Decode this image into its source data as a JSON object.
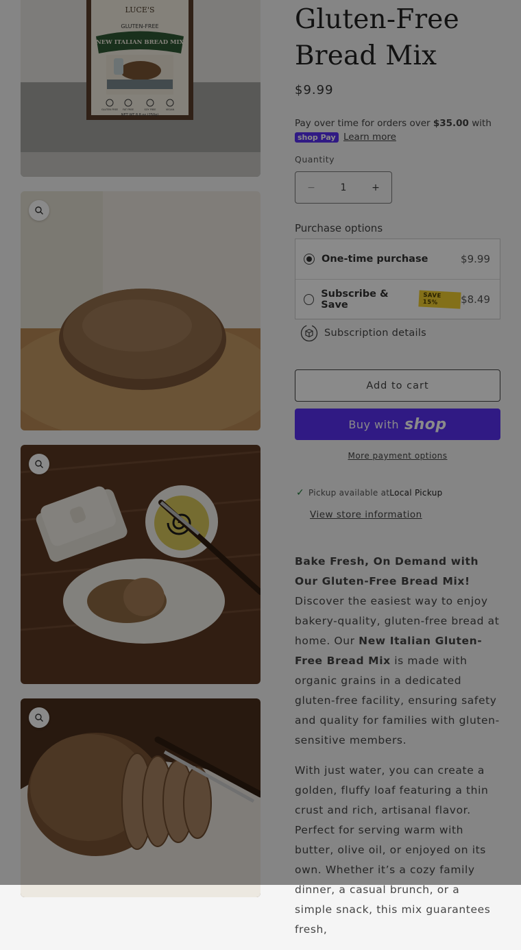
{
  "product": {
    "title": "Gluten-Free Bread Mix",
    "price": "$9.99",
    "installments": {
      "text": "Pay over time for orders over ",
      "threshold": "$35.00",
      "text_after": " with",
      "shoppay": "shop Pay",
      "learn_more": "Learn more"
    },
    "package": {
      "brand": "LUCE'S",
      "tag": "GLUTEN-FREE",
      "name": "NEW ITALIAN BREAD MIX",
      "net_wt": "NET WT 8.8 oz (250g)",
      "labels": [
        "GLUTEN FREE",
        "FAT FREE",
        "SOY FREE",
        "VEGAN"
      ]
    }
  },
  "quantity": {
    "label": "Quantity",
    "minus": "−",
    "value": "1",
    "plus": "+"
  },
  "purchase_options": {
    "label": "Purchase options",
    "options": [
      {
        "name": "One-time purchase",
        "price": "$9.99",
        "selected": true
      },
      {
        "name": "Subscribe & Save",
        "badge": "SAVE 15%",
        "price": "$8.49",
        "selected": false
      }
    ],
    "subscription_details": "Subscription details"
  },
  "buttons": {
    "add_to_cart": "Add to cart",
    "buy_with": "Buy with",
    "shop_logo": "shop",
    "more_payment": "More payment options"
  },
  "pickup": {
    "available": "Pickup available at ",
    "location": "Local Pickup",
    "store_info": "View store information"
  },
  "description": {
    "heading": "Bake Fresh, On Demand with Our Gluten-Free Bread Mix!",
    "p1_start": "Discover the easiest way to enjoy bakery-quality, gluten-free bread at home. Our ",
    "p1_bold": "New Italian Gluten-Free Bread Mix",
    "p1_end": " is made with organic grains in a dedicated gluten-free facility, ensuring safety and quality for families with gluten-sensitive members.",
    "p2": "With just water, you can create a golden, fluffy loaf featuring a thin crust and rich, artisanal flavor. Perfect for serving warm with butter, olive oil, or enjoyed on its own. Whether it’s a cozy family dinner, a casual brunch, or a simple snack, this mix guarantees fresh,"
  },
  "colors": {
    "accent": "#5a31f4",
    "badge": "#f2cf2f",
    "check": "#1f7a3a",
    "overlay": "rgba(0,0,0,0.46)"
  }
}
